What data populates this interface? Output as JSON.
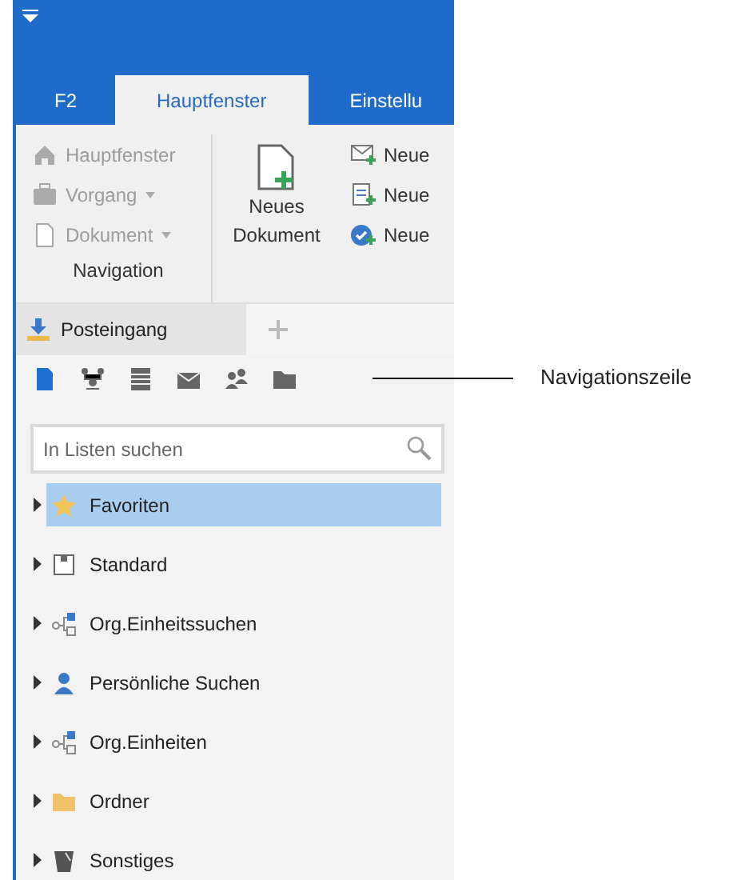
{
  "ribbon_tabs": [
    {
      "label": "F2",
      "selected": false
    },
    {
      "label": "Hauptfenster",
      "selected": true
    },
    {
      "label": "Einstellu",
      "selected": false
    }
  ],
  "navigation_group": {
    "title": "Navigation",
    "items": [
      {
        "kind": "home",
        "label": "Hauptfenster",
        "dropdown": false,
        "disabled": true
      },
      {
        "kind": "case",
        "label": "Vorgang",
        "dropdown": true,
        "disabled": true
      },
      {
        "kind": "document",
        "label": "Dokument",
        "dropdown": true,
        "disabled": true
      }
    ]
  },
  "new_document": {
    "label": "Neues Dokument"
  },
  "new_items": [
    {
      "kind": "mail",
      "label": "Neue"
    },
    {
      "kind": "form",
      "label": "Neue"
    },
    {
      "kind": "task",
      "label": "Neue"
    }
  ],
  "doc_tabs": [
    {
      "label": "Posteingang",
      "selected": true
    }
  ],
  "nav_icons": [
    {
      "kind": "document",
      "selected": true
    },
    {
      "kind": "org",
      "selected": false
    },
    {
      "kind": "list",
      "selected": false
    },
    {
      "kind": "mail",
      "selected": false
    },
    {
      "kind": "people",
      "selected": false
    },
    {
      "kind": "folder",
      "selected": false
    }
  ],
  "search": {
    "placeholder": "In Listen suchen"
  },
  "tree": [
    {
      "kind": "star",
      "label": "Favoriten",
      "selected": true,
      "expanded": false
    },
    {
      "kind": "standard",
      "label": "Standard",
      "selected": false,
      "expanded": false
    },
    {
      "kind": "org",
      "label": "Org.Einheitssuchen",
      "selected": false,
      "expanded": false
    },
    {
      "kind": "person",
      "label": "Persönliche Suchen",
      "selected": false,
      "expanded": false
    },
    {
      "kind": "org",
      "label": "Org.Einheiten",
      "selected": false,
      "expanded": false
    },
    {
      "kind": "folder",
      "label": "Ordner",
      "selected": false,
      "expanded": false
    },
    {
      "kind": "misc",
      "label": "Sonstiges",
      "selected": false,
      "expanded": false
    }
  ],
  "annotation": {
    "label": "Navigationszeile"
  }
}
